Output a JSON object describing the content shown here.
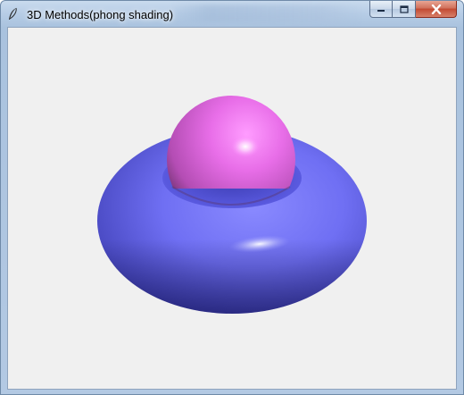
{
  "window": {
    "title": "3D Methods(phong shading)",
    "icon": "feather-icon"
  },
  "controls": {
    "minimize_icon": "minimize-icon",
    "maximize_icon": "maximize-icon",
    "close_icon": "close-icon"
  },
  "scene": {
    "torus_color": "#6e6ef5",
    "sphere_color": "#e06ae0",
    "background": "#f0f0f0"
  }
}
